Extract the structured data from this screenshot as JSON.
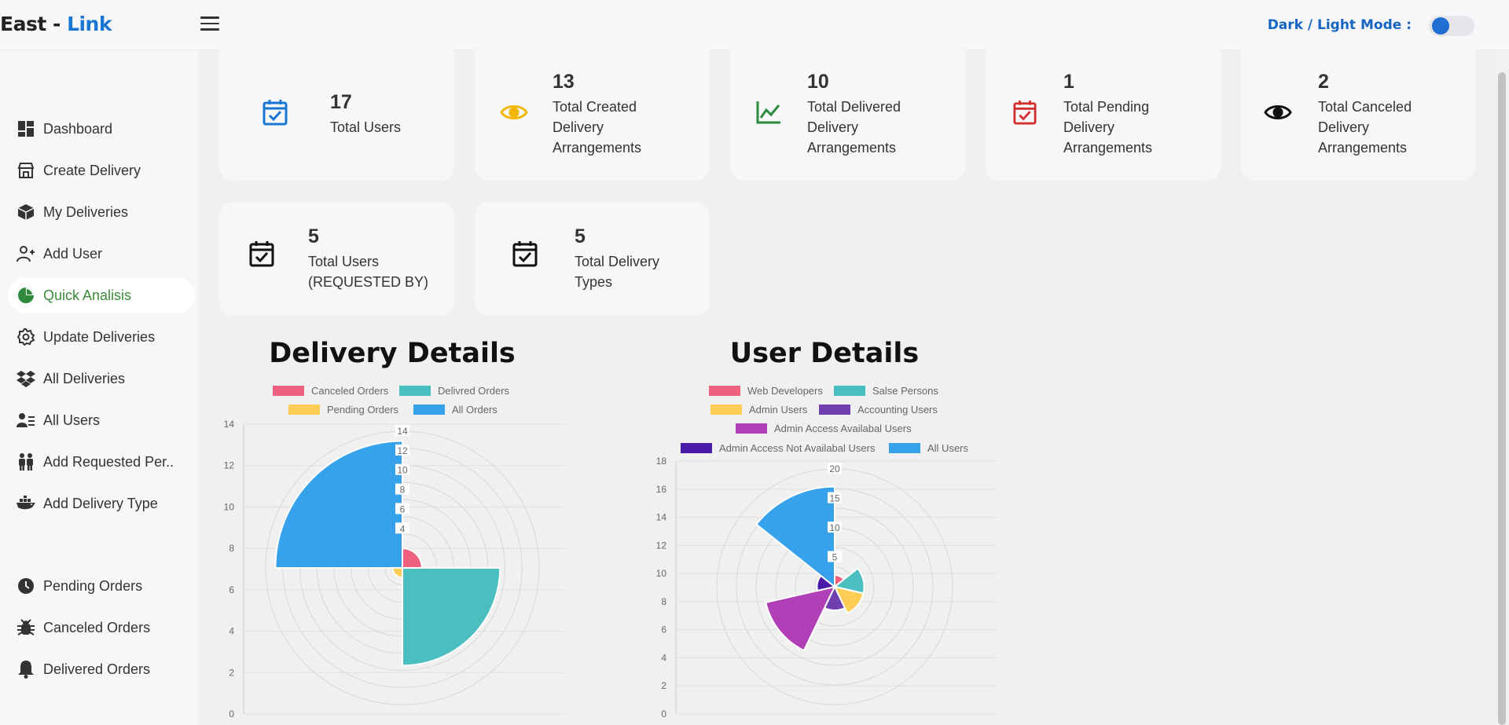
{
  "header": {
    "brand_part1": "East - ",
    "brand_part2": "Link",
    "mode_label": "Dark / Light Mode :"
  },
  "sidebar": {
    "items": [
      {
        "label": "Dashboard",
        "icon": "dashboard-icon"
      },
      {
        "label": "Create Delivery",
        "icon": "storefront-icon"
      },
      {
        "label": "My Deliveries",
        "icon": "package-icon"
      },
      {
        "label": "Add User",
        "icon": "person-add-icon"
      },
      {
        "label": "Quick Analisis",
        "icon": "pie-chart-icon",
        "active": true
      },
      {
        "label": "Update Deliveries",
        "icon": "gear-icon"
      },
      {
        "label": "All Deliveries",
        "icon": "dropbox-icon"
      },
      {
        "label": "All Users",
        "icon": "user-list-icon"
      },
      {
        "label": "Add Requested Per..",
        "icon": "people-icon"
      },
      {
        "label": "Add Delivery Type",
        "icon": "ship-icon"
      },
      {
        "label": "Pending Orders",
        "icon": "clock-icon"
      },
      {
        "label": "Canceled Orders",
        "icon": "bug-icon"
      },
      {
        "label": "Delivered Orders",
        "icon": "bell-icon"
      }
    ]
  },
  "stats": [
    {
      "value": "17",
      "label_lines": [
        "Total Users"
      ],
      "icon": "calendar-check-icon",
      "color": "#1976d2",
      "bg": "#cfe4f8"
    },
    {
      "value": "13",
      "label_lines": [
        "Total Created",
        "Delivery",
        "Arrangements"
      ],
      "icon": "eye-icon",
      "color": "#f2b705",
      "bg": "#fdf0c4"
    },
    {
      "value": "10",
      "label_lines": [
        "Total Delivered",
        "Delivery",
        "Arrangements"
      ],
      "icon": "trend-chart-icon",
      "color": "#2e8b3e",
      "bg": "#c3f3cf"
    },
    {
      "value": "1",
      "label_lines": [
        "Total Pending",
        "Delivery",
        "Arrangements"
      ],
      "icon": "calendar-check-icon",
      "color": "#d32f2f",
      "bg": "#fcd3d6"
    },
    {
      "value": "2",
      "label_lines": [
        "Total Canceled",
        "Delivery",
        "Arrangements"
      ],
      "icon": "eye-icon",
      "color": "#111111",
      "bg": "transparent"
    },
    {
      "value": "5",
      "label_lines": [
        "Total Users",
        "(REQUESTED BY)"
      ],
      "icon": "calendar-check-icon",
      "color": "#111111",
      "bg": "transparent"
    },
    {
      "value": "5",
      "label_lines": [
        "Total Delivery",
        "Types"
      ],
      "icon": "calendar-check-icon",
      "color": "#111111",
      "bg": "transparent"
    }
  ],
  "chart_data": [
    {
      "type": "polarArea",
      "title": "Delivery Details",
      "categories": [
        "Canceled Orders",
        "Delivred Orders",
        "Pending Orders",
        "All Orders"
      ],
      "values": [
        2,
        10,
        1,
        13
      ],
      "colors": [
        "#f0607f",
        "#4bbfbf",
        "#fdcd56",
        "#36a2eb"
      ],
      "y_ticks": [
        "0",
        "2",
        "4",
        "6",
        "8",
        "10",
        "12",
        "14"
      ],
      "r_ticks": [
        "4",
        "6",
        "8",
        "10",
        "12",
        "14"
      ],
      "r_max": 14,
      "legend_position": "top"
    },
    {
      "type": "polarArea",
      "title": "User Details",
      "categories": [
        "Web Developers",
        "Salse Persons",
        "Admin Users",
        "Accounting Users",
        "Admin Access Availabal Users",
        "Admin Access Not Availabal Users",
        "All Users"
      ],
      "values": [
        2,
        5,
        5,
        4,
        12,
        3,
        17
      ],
      "colors": [
        "#f0607f",
        "#4bbfbf",
        "#fdcd56",
        "#6f3fb0",
        "#b140b8",
        "#4a1aa8",
        "#36a2eb"
      ],
      "y_ticks": [
        "0",
        "2",
        "4",
        "6",
        "8",
        "10",
        "12",
        "14",
        "16",
        "18"
      ],
      "r_ticks": [
        "5",
        "10",
        "15",
        "20"
      ],
      "r_max": 20,
      "legend_position": "top"
    }
  ]
}
